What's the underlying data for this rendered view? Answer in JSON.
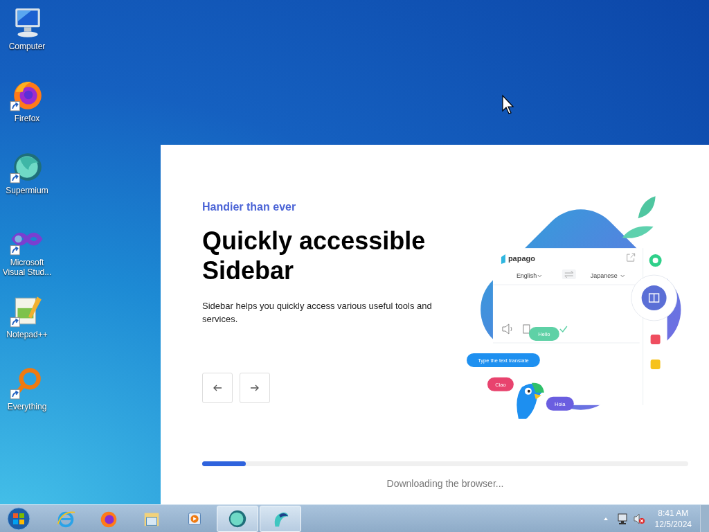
{
  "desktop_icons": [
    {
      "label": "Computer",
      "kind": "computer",
      "shortcut": false
    },
    {
      "label": "Firefox",
      "kind": "firefox",
      "shortcut": true
    },
    {
      "label": "Supermium",
      "kind": "supermium",
      "shortcut": true
    },
    {
      "label": "Microsoft Visual Stud...",
      "kind": "visual_studio",
      "shortcut": true
    },
    {
      "label": "Notepad++",
      "kind": "notepadpp",
      "shortcut": true
    },
    {
      "label": "Everything",
      "kind": "everything",
      "shortcut": true
    }
  ],
  "installer": {
    "eyebrow": "Handier than ever",
    "title": "Quickly accessible Sidebar",
    "description": "Sidebar helps you quickly access various useful tools and services.",
    "progress": {
      "level": 0.09
    },
    "status": "Downloading the browser..."
  },
  "illustration": {
    "app_name": "papago",
    "source_language": "English",
    "target_language": "Japanese",
    "bubbles": [
      {
        "text": "Hello",
        "color": "#5ed1a6"
      },
      {
        "text": "Type the text translate",
        "color": "#1e90f0"
      },
      {
        "text": "Ciao",
        "color": "#e8436e"
      },
      {
        "text": "Hola",
        "color": "#6a5ee0"
      }
    ]
  },
  "taskbar": {
    "pinned": [
      {
        "kind": "ie",
        "active": false
      },
      {
        "kind": "firefox",
        "active": false
      },
      {
        "kind": "explorer",
        "active": false
      },
      {
        "kind": "media_player",
        "active": false
      },
      {
        "kind": "supermium",
        "active": true
      },
      {
        "kind": "setup",
        "active": true
      }
    ],
    "clock": {
      "time": "8:41 AM",
      "date": "12/5/2024"
    }
  }
}
